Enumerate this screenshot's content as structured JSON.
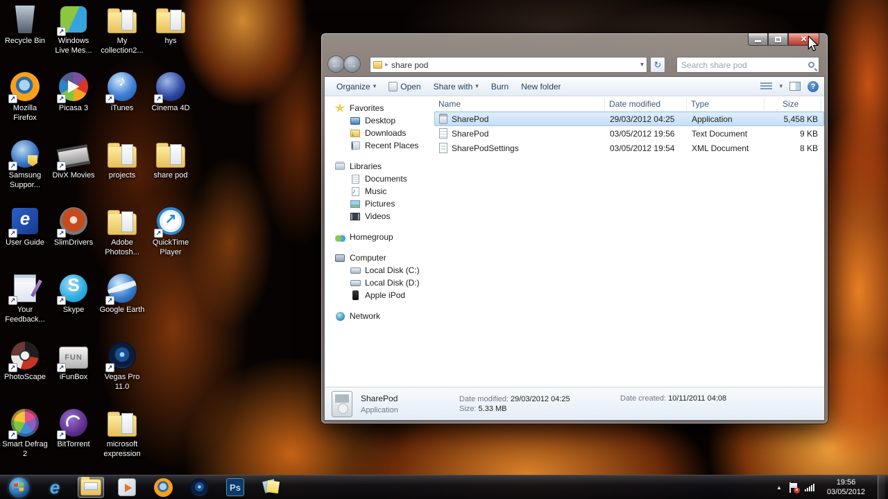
{
  "desktop": {
    "icons": [
      {
        "label": "Recycle Bin",
        "icon": "recycle-bin",
        "col": 0,
        "row": 0,
        "shortcut": false
      },
      {
        "label": "Windows Live Mes...",
        "icon": "wlm",
        "col": 1,
        "row": 0,
        "shortcut": true
      },
      {
        "label": "My collection2...",
        "icon": "folder",
        "col": 2,
        "row": 0,
        "shortcut": false
      },
      {
        "label": "hys",
        "icon": "folder",
        "col": 3,
        "row": 0,
        "shortcut": false
      },
      {
        "label": "Mozilla Firefox",
        "icon": "firefox",
        "col": 0,
        "row": 1,
        "shortcut": true
      },
      {
        "label": "Picasa 3",
        "icon": "picasa",
        "col": 1,
        "row": 1,
        "shortcut": true
      },
      {
        "label": "iTunes",
        "icon": "itunes",
        "col": 2,
        "row": 1,
        "shortcut": true
      },
      {
        "label": "Cinema 4D",
        "icon": "cinema4d",
        "col": 3,
        "row": 1,
        "shortcut": true
      },
      {
        "label": "Samsung Suppor...",
        "icon": "samsung",
        "col": 0,
        "row": 2,
        "shortcut": true
      },
      {
        "label": "DivX Movies",
        "icon": "divx",
        "col": 1,
        "row": 2,
        "shortcut": true
      },
      {
        "label": "projects",
        "icon": "folder",
        "col": 2,
        "row": 2,
        "shortcut": false
      },
      {
        "label": "share pod",
        "icon": "folder",
        "col": 3,
        "row": 2,
        "shortcut": false
      },
      {
        "label": "User Guide",
        "icon": "user-guide",
        "col": 0,
        "row": 3,
        "shortcut": true
      },
      {
        "label": "SlimDrivers",
        "icon": "slimdrivers",
        "col": 1,
        "row": 3,
        "shortcut": true
      },
      {
        "label": "Adobe Photosh...",
        "icon": "folder",
        "col": 2,
        "row": 3,
        "shortcut": false
      },
      {
        "label": "QuickTime Player",
        "icon": "quicktime",
        "col": 3,
        "row": 3,
        "shortcut": true
      },
      {
        "label": "Your Feedback...",
        "icon": "feedback",
        "col": 0,
        "row": 4,
        "shortcut": true
      },
      {
        "label": "Skype",
        "icon": "skype",
        "col": 1,
        "row": 4,
        "shortcut": true
      },
      {
        "label": "Google Earth",
        "icon": "google-earth",
        "col": 2,
        "row": 4,
        "shortcut": true
      },
      {
        "label": "PhotoScape",
        "icon": "photoscape",
        "col": 0,
        "row": 5,
        "shortcut": true
      },
      {
        "label": "iFunBox",
        "icon": "ifunbox",
        "col": 1,
        "row": 5,
        "shortcut": true
      },
      {
        "label": "Vegas Pro 11.0",
        "icon": "vegas",
        "col": 2,
        "row": 5,
        "shortcut": true
      },
      {
        "label": "Smart Defrag 2",
        "icon": "smart-defrag",
        "col": 0,
        "row": 6,
        "shortcut": true
      },
      {
        "label": "BitTorrent",
        "icon": "bittorrent",
        "col": 1,
        "row": 6,
        "shortcut": true
      },
      {
        "label": "microsoft expression",
        "icon": "folder",
        "col": 2,
        "row": 6,
        "shortcut": false
      }
    ]
  },
  "explorer": {
    "address": "share pod",
    "search_placeholder": "Search share pod",
    "toolbar": {
      "organize": "Organize",
      "open": "Open",
      "share_with": "Share with",
      "burn": "Burn",
      "new_folder": "New folder"
    },
    "sidebar": [
      {
        "label": "Favorites",
        "icon": "star",
        "children": [
          {
            "label": "Desktop",
            "icon": "desktop"
          },
          {
            "label": "Downloads",
            "icon": "downloads"
          },
          {
            "label": "Recent Places",
            "icon": "recent"
          }
        ]
      },
      {
        "label": "Libraries",
        "icon": "libraries",
        "children": [
          {
            "label": "Documents",
            "icon": "documents"
          },
          {
            "label": "Music",
            "icon": "music"
          },
          {
            "label": "Pictures",
            "icon": "pictures"
          },
          {
            "label": "Videos",
            "icon": "videos"
          }
        ]
      },
      {
        "label": "Homegroup",
        "icon": "homegroup",
        "children": []
      },
      {
        "label": "Computer",
        "icon": "computer",
        "children": [
          {
            "label": "Local Disk (C:)",
            "icon": "disk"
          },
          {
            "label": "Local Disk (D:)",
            "icon": "disk"
          },
          {
            "label": "Apple iPod",
            "icon": "ipod"
          }
        ]
      },
      {
        "label": "Network",
        "icon": "network",
        "children": []
      }
    ],
    "columns": [
      "Name",
      "Date modified",
      "Type",
      "Size"
    ],
    "files": [
      {
        "name": "SharePod",
        "modified": "29/03/2012 04:25",
        "type": "Application",
        "size": "5,458 KB",
        "icon": "app",
        "selected": true
      },
      {
        "name": "SharePod",
        "modified": "03/05/2012 19:56",
        "type": "Text Document",
        "size": "9 KB",
        "icon": "text",
        "selected": false
      },
      {
        "name": "SharePodSettings",
        "modified": "03/05/2012 19:54",
        "type": "XML Document",
        "size": "8 KB",
        "icon": "xml",
        "selected": false
      }
    ],
    "details": {
      "name": "SharePod",
      "type": "Application",
      "modified_label": "Date modified:",
      "modified": "29/03/2012 04:25",
      "size_label": "Size:",
      "size": "5.33 MB",
      "created_label": "Date created:",
      "created": "10/11/2011 04:08"
    }
  },
  "taskbar": {
    "items": [
      {
        "icon": "start",
        "active": false
      },
      {
        "icon": "ie",
        "active": false
      },
      {
        "icon": "explorer",
        "active": true
      },
      {
        "icon": "wmp",
        "active": false
      },
      {
        "icon": "firefox",
        "active": false
      },
      {
        "icon": "vegas",
        "active": false
      },
      {
        "icon": "photoshop",
        "active": false
      },
      {
        "icon": "sticky-notes",
        "active": false
      }
    ],
    "clock": {
      "time": "19:56",
      "date": "03/05/2012"
    }
  }
}
